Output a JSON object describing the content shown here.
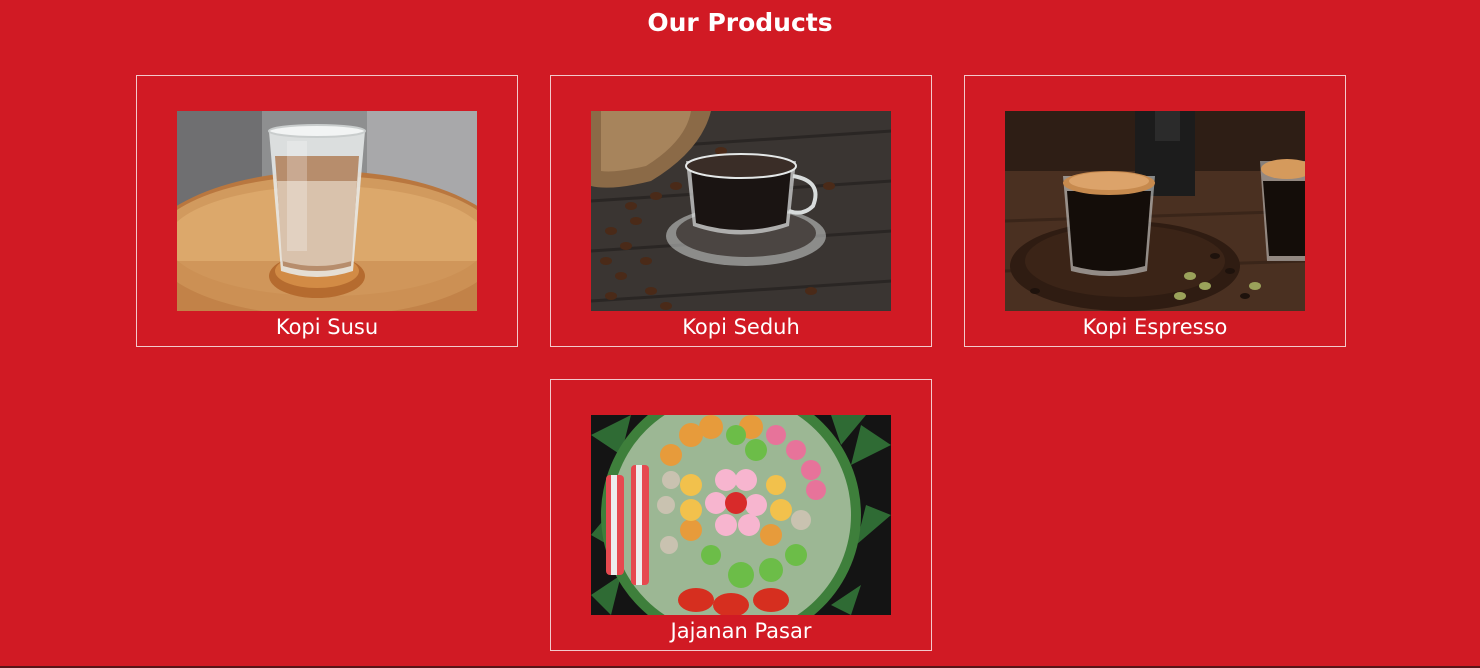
{
  "products_section": {
    "title": "Our Products",
    "items": [
      {
        "name": "Kopi Susu",
        "image": "iced-milk-coffee-glass"
      },
      {
        "name": "Kopi Seduh",
        "image": "black-coffee-cup-with-beans"
      },
      {
        "name": "Kopi Espresso",
        "image": "espresso-glasses-on-wood"
      },
      {
        "name": "Jajanan Pasar",
        "image": "traditional-snack-platter"
      }
    ]
  },
  "colors": {
    "background": "#d11a24",
    "text": "#ffffff",
    "card_border": "#f3c9cb"
  }
}
